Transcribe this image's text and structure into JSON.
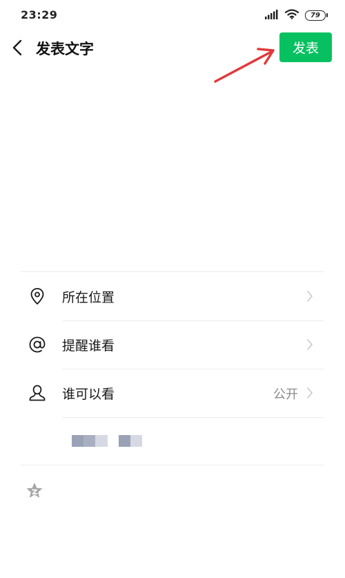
{
  "status_bar": {
    "time": "23:29",
    "battery": "79"
  },
  "nav": {
    "title": "发表文字",
    "publish_label": "发表"
  },
  "composer": {
    "placeholder": ""
  },
  "options": [
    {
      "label": "所在位置",
      "value": ""
    },
    {
      "label": "提醒谁看",
      "value": ""
    },
    {
      "label": "谁可以看",
      "value": "公开"
    }
  ],
  "colors": {
    "accent": "#07c160",
    "annotation": "#e03a3a",
    "blur_tiles": [
      "#9aa2b6",
      "#b8bccc",
      "#d6d9e3",
      "#a9afc2",
      "#c7cad6"
    ]
  }
}
